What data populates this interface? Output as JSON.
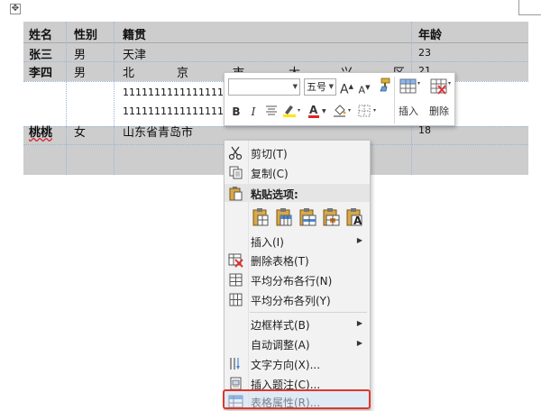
{
  "table": {
    "headers": [
      "姓名",
      "性别",
      "籍贯",
      "年龄"
    ],
    "rows": [
      {
        "name": "张三",
        "gender": "男",
        "origin": "天津",
        "age": "23"
      },
      {
        "name": "李四",
        "gender": "男",
        "origin_chars": [
          "北",
          "京",
          "市",
          "大",
          "兴",
          "区"
        ],
        "age": "21",
        "extra_lines": [
          "1111111111111111",
          "1111111111111111"
        ]
      },
      {
        "name": "桃桃",
        "gender": "女",
        "origin": "山东省青岛市",
        "age": "18"
      }
    ]
  },
  "mini_toolbar": {
    "font_name": "",
    "font_size": "五号",
    "grow_font": "A",
    "shrink_font": "A",
    "bold": "B",
    "italic": "I",
    "font_color_glyph": "A",
    "insert_label": "插入",
    "delete_label": "删除"
  },
  "context_menu": {
    "items": [
      {
        "label": "剪切(T)",
        "icon": "scissors-icon"
      },
      {
        "label": "复制(C)",
        "icon": "copy-icon"
      },
      {
        "label": "粘贴选项:",
        "icon": "paste-icon"
      },
      {
        "label": "插入(I)",
        "icon": "",
        "submenu": true
      },
      {
        "label": "删除表格(T)",
        "icon": "delete-table-icon"
      },
      {
        "label": "平均分布各行(N)",
        "icon": "distribute-rows-icon"
      },
      {
        "label": "平均分布各列(Y)",
        "icon": "distribute-columns-icon"
      },
      {
        "label": "边框样式(B)",
        "icon": "",
        "submenu": true
      },
      {
        "label": "自动调整(A)",
        "icon": "",
        "submenu": true
      },
      {
        "label": "文字方向(X)...",
        "icon": "text-direction-icon"
      },
      {
        "label": "插入题注(C)...",
        "icon": "insert-caption-icon"
      },
      {
        "label": "表格属性(R)...",
        "icon": "table-properties-icon"
      }
    ],
    "paste_options": [
      "paste-nest-table-icon",
      "paste-merge-table-icon",
      "paste-insert-rows-icon",
      "paste-overwrite-cells-icon",
      "paste-keep-text-only-icon"
    ],
    "paste_text_only_glyph": "A"
  },
  "colors": {
    "table_shading": "#cdcdcd",
    "highlight_border": "#e0372b",
    "font_color_red": "#e02424",
    "highlighter_yellow": "#ffe600"
  }
}
